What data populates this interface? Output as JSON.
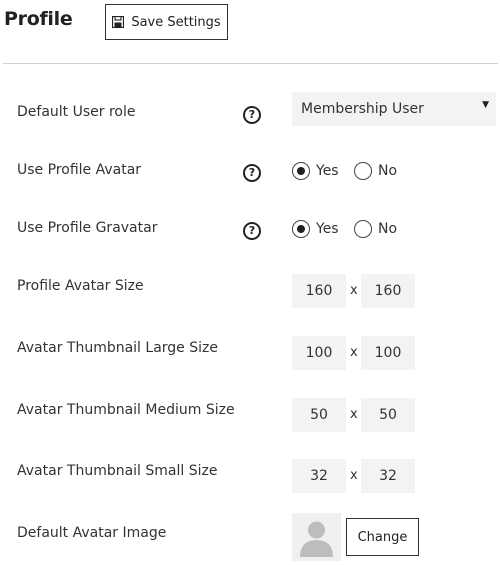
{
  "header": {
    "title": "Profile",
    "save_label": "Save Settings"
  },
  "rows": {
    "default_user_role": {
      "label": "Default User role",
      "selected": "Membership User"
    },
    "use_profile_avatar": {
      "label": "Use Profile Avatar",
      "yes": "Yes",
      "no": "No",
      "value": "Yes"
    },
    "use_profile_gravatar": {
      "label": "Use Profile Gravatar",
      "yes": "Yes",
      "no": "No",
      "value": "Yes"
    },
    "profile_avatar_size": {
      "label": "Profile Avatar Size",
      "width": "160",
      "height": "160"
    },
    "thumb_large": {
      "label": "Avatar Thumbnail Large Size",
      "width": "100",
      "height": "100"
    },
    "thumb_medium": {
      "label": "Avatar Thumbnail Medium Size",
      "width": "50",
      "height": "50"
    },
    "thumb_small": {
      "label": "Avatar Thumbnail Small Size",
      "width": "32",
      "height": "32"
    },
    "default_avatar": {
      "label": "Default Avatar Image",
      "change_label": "Change"
    }
  },
  "glyphs": {
    "help": "?",
    "times": "x",
    "dropdown": "▼"
  },
  "icons": {
    "save": "floppy-disk-icon",
    "help": "question-circle-icon",
    "avatar": "user-silhouette-icon"
  }
}
